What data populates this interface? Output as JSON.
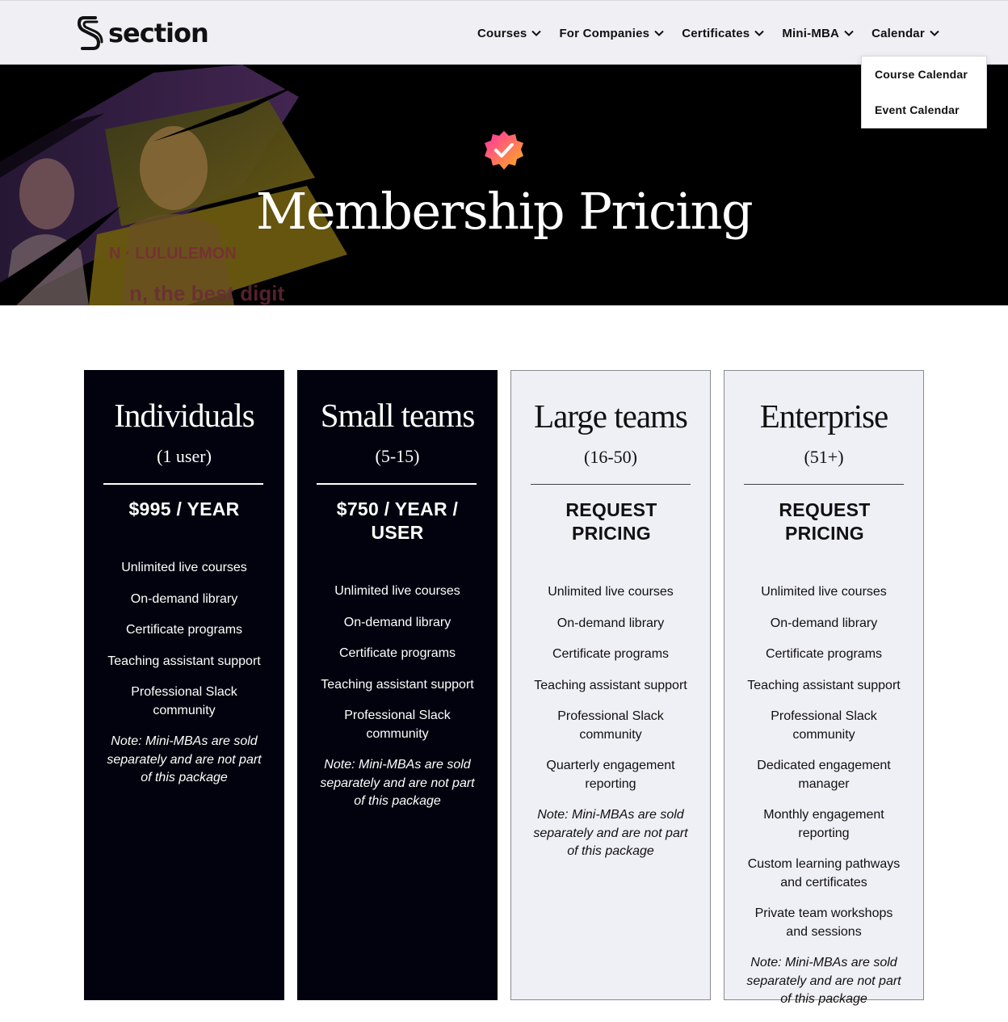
{
  "brand": {
    "name": "section"
  },
  "nav": {
    "items": [
      {
        "label": "Courses"
      },
      {
        "label": "For Companies"
      },
      {
        "label": "Certificates"
      },
      {
        "label": "Mini-MBA"
      },
      {
        "label": "Calendar"
      }
    ],
    "open_dropdown": {
      "parent": "Calendar",
      "items": [
        {
          "label": "Course Calendar"
        },
        {
          "label": "Event Calendar"
        }
      ]
    }
  },
  "hero": {
    "title": "Membership Pricing",
    "badge_icon": "verified-check-badge-icon",
    "collage_text_1": "N · LULULEMON",
    "collage_text_2": "n, the best digit"
  },
  "plans": [
    {
      "title": "Individuals",
      "subtitle": "(1 user)",
      "price": "$995 / YEAR",
      "features": [
        "Unlimited live courses",
        "On-demand library",
        "Certificate programs",
        "Teaching assistant support",
        "Professional Slack community"
      ],
      "note": "Note: Mini-MBAs are sold separately and are not part of this package"
    },
    {
      "title": "Small teams",
      "subtitle": "(5-15)",
      "price": "$750 / YEAR / USER",
      "features": [
        "Unlimited live courses",
        "On-demand library",
        "Certificate programs",
        "Teaching assistant support",
        "Professional Slack community"
      ],
      "note": "Note: Mini-MBAs are sold separately and are not part of this package"
    },
    {
      "title": "Large teams",
      "subtitle": "(16-50)",
      "price": "REQUEST PRICING",
      "features": [
        "Unlimited live courses",
        "On-demand library",
        "Certificate programs",
        "Teaching assistant support",
        "Professional Slack community",
        "Quarterly engagement reporting"
      ],
      "note": "Note: Mini-MBAs are sold separately and are not part of this package"
    },
    {
      "title": "Enterprise",
      "subtitle": "(51+)",
      "price": "REQUEST PRICING",
      "features": [
        "Unlimited live courses",
        "On-demand library",
        "Certificate programs",
        "Teaching assistant support",
        "Professional Slack community",
        "Dedicated engagement manager",
        "Monthly engagement reporting",
        "Custom learning pathways and certificates",
        "Private team workshops and sessions"
      ],
      "note": "Note: Mini-MBAs are sold separately and are not part of this package"
    }
  ],
  "colors": {
    "header_bg": "#efeff4",
    "hero_bg": "#000000",
    "dark_card_bg": "#02020e",
    "light_card_bg": "#efeff6",
    "badge_gradient": [
      "#ff2fa8",
      "#ffb21a"
    ]
  }
}
